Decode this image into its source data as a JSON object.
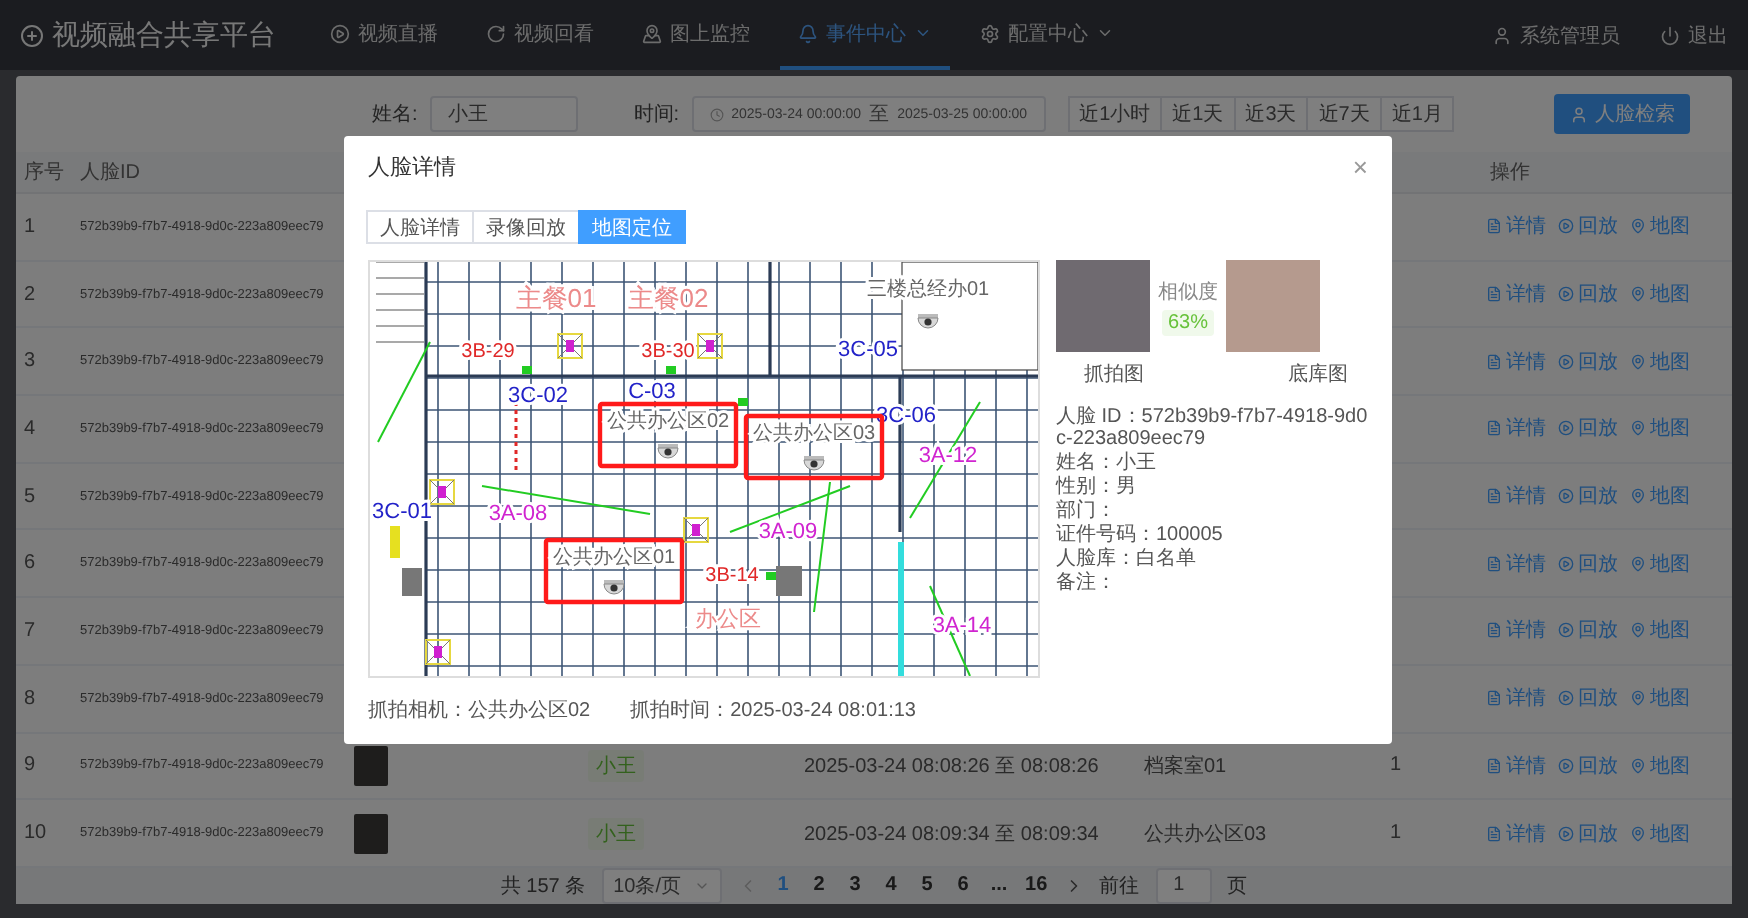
{
  "brand": {
    "title": "视频融合共享平台"
  },
  "nav": [
    {
      "label": "视频直播",
      "kind": "live",
      "selected": false,
      "dropdown": false
    },
    {
      "label": "视频回看",
      "kind": "playback",
      "selected": false,
      "dropdown": false
    },
    {
      "label": "图上监控",
      "kind": "map",
      "selected": false,
      "dropdown": false
    },
    {
      "label": "事件中心",
      "kind": "events",
      "selected": true,
      "dropdown": true
    },
    {
      "label": "配置中心",
      "kind": "config",
      "selected": false,
      "dropdown": true
    }
  ],
  "user": {
    "name": "系统管理员"
  },
  "logout": {
    "label": "退出"
  },
  "filters": {
    "name_label": "姓名:",
    "name_value": "小王",
    "time_label": "时间:",
    "start": "2025-03-24 00:00:00",
    "range_sep": "至",
    "end": "2025-03-25 00:00:00",
    "quick_ranges": [
      {
        "label": "近1小时"
      },
      {
        "label": "近1天"
      },
      {
        "label": "近3天"
      },
      {
        "label": "近7天"
      },
      {
        "label": "近1月"
      }
    ],
    "search_button": "人脸检索"
  },
  "table": {
    "columns": [
      {
        "label": "序号",
        "kind": "index"
      },
      {
        "label": "人脸ID",
        "kind": "id"
      },
      {
        "label": "操作",
        "kind": "actions"
      }
    ],
    "rows": [
      {
        "index": "1",
        "face_id": "572b39b9-f7b7-4918-9d0c-223a809eec79",
        "actions": [
          {
            "label": "详情",
            "kind": "detail"
          },
          {
            "label": "回放",
            "kind": "playback"
          },
          {
            "label": "地图",
            "kind": "map"
          }
        ]
      },
      {
        "index": "2",
        "face_id": "572b39b9-f7b7-4918-9d0c-223a809eec79",
        "actions": [
          {
            "label": "详情",
            "kind": "detail"
          },
          {
            "label": "回放",
            "kind": "playback"
          },
          {
            "label": "地图",
            "kind": "map"
          }
        ]
      },
      {
        "index": "3",
        "face_id": "572b39b9-f7b7-4918-9d0c-223a809eec79",
        "actions": [
          {
            "label": "详情",
            "kind": "detail"
          },
          {
            "label": "回放",
            "kind": "playback"
          },
          {
            "label": "地图",
            "kind": "map"
          }
        ]
      },
      {
        "index": "4",
        "face_id": "572b39b9-f7b7-4918-9d0c-223a809eec79",
        "actions": [
          {
            "label": "详情",
            "kind": "detail"
          },
          {
            "label": "回放",
            "kind": "playback"
          },
          {
            "label": "地图",
            "kind": "map"
          }
        ]
      },
      {
        "index": "5",
        "face_id": "572b39b9-f7b7-4918-9d0c-223a809eec79",
        "actions": [
          {
            "label": "详情",
            "kind": "detail"
          },
          {
            "label": "回放",
            "kind": "playback"
          },
          {
            "label": "地图",
            "kind": "map"
          }
        ]
      },
      {
        "index": "6",
        "face_id": "572b39b9-f7b7-4918-9d0c-223a809eec79",
        "actions": [
          {
            "label": "详情",
            "kind": "detail"
          },
          {
            "label": "回放",
            "kind": "playback"
          },
          {
            "label": "地图",
            "kind": "map"
          }
        ]
      },
      {
        "index": "7",
        "face_id": "572b39b9-f7b7-4918-9d0c-223a809eec79",
        "actions": [
          {
            "label": "详情",
            "kind": "detail"
          },
          {
            "label": "回放",
            "kind": "playback"
          },
          {
            "label": "地图",
            "kind": "map"
          }
        ]
      },
      {
        "index": "8",
        "face_id": "572b39b9-f7b7-4918-9d0c-223a809eec79",
        "actions": [
          {
            "label": "详情",
            "kind": "detail"
          },
          {
            "label": "回放",
            "kind": "playback"
          },
          {
            "label": "地图",
            "kind": "map"
          }
        ]
      },
      {
        "index": "9",
        "face_id": "572b39b9-f7b7-4918-9d0c-223a809eec79",
        "name": "小王",
        "time": "2025-03-24 08:08:26 至 08:08:26",
        "location": "档案室01",
        "count": "1",
        "actions": [
          {
            "label": "详情",
            "kind": "detail"
          },
          {
            "label": "回放",
            "kind": "playback"
          },
          {
            "label": "地图",
            "kind": "map"
          }
        ]
      },
      {
        "index": "10",
        "face_id": "572b39b9-f7b7-4918-9d0c-223a809eec79",
        "name": "小王",
        "time": "2025-03-24 08:09:34 至 08:09:34",
        "location": "公共办公区03",
        "count": "1",
        "actions": [
          {
            "label": "详情",
            "kind": "detail"
          },
          {
            "label": "回放",
            "kind": "playback"
          },
          {
            "label": "地图",
            "kind": "map"
          }
        ]
      }
    ]
  },
  "pagination": {
    "total": "共 157 条",
    "page_size": "10条/页",
    "pages": [
      {
        "label": "1",
        "selected": true
      },
      {
        "label": "2",
        "selected": false
      },
      {
        "label": "3",
        "selected": false
      },
      {
        "label": "4",
        "selected": false
      },
      {
        "label": "5",
        "selected": false
      },
      {
        "label": "6",
        "selected": false
      },
      {
        "label": "...",
        "selected": false
      },
      {
        "label": "16",
        "selected": false
      }
    ],
    "goto_label": "前往",
    "goto_value": "1",
    "page_unit": "页"
  },
  "modal": {
    "title": "人脸详情",
    "close": "×",
    "tabs": [
      {
        "label": "人脸详情",
        "selected": false
      },
      {
        "label": "录像回放",
        "selected": false
      },
      {
        "label": "地图定位",
        "selected": true
      }
    ],
    "map": {
      "rooms": [
        {
          "label": "主餐01",
          "color": "#ec8a8a"
        },
        {
          "label": "主餐02",
          "color": "#ec8a8a"
        },
        {
          "label": "3B-29",
          "color": "#e02828"
        },
        {
          "label": "3B-30",
          "color": "#e02828"
        },
        {
          "label": "3C-05",
          "color": "#2222c8"
        },
        {
          "label": "3C-02",
          "color": "#2222c8"
        },
        {
          "label": "C-03",
          "color": "#2222c8"
        },
        {
          "label": "3C-06",
          "color": "#2222c8"
        },
        {
          "label": "3A-12",
          "color": "#d024d0"
        },
        {
          "label": "3C-01",
          "color": "#2222c8"
        },
        {
          "label": "3A-08",
          "color": "#d024d0"
        },
        {
          "label": "3A-09",
          "color": "#d024d0"
        },
        {
          "label": "3B-14",
          "color": "#e02828"
        },
        {
          "label": "办公区",
          "color": "#ec8a8a"
        },
        {
          "label": "3A-14",
          "color": "#d024d0"
        }
      ],
      "cameras": [
        {
          "label": "三楼总经办01",
          "highlighted": false
        },
        {
          "label": "公共办公区02",
          "highlighted": true
        },
        {
          "label": "公共办公区03",
          "highlighted": true
        },
        {
          "label": "公共办公区01",
          "highlighted": true
        }
      ]
    },
    "similarity": {
      "label": "相似度",
      "value": "63%"
    },
    "captions": [
      "抓拍图",
      "底库图"
    ],
    "info": [
      "人脸 ID：572b39b9-f7b7-4918-9d0c-223a809eec79",
      "姓名：小王",
      "性别：男",
      "部门：",
      "证件号码：100005",
      "人脸库：白名单",
      "备注："
    ],
    "footer": [
      "抓拍相机：公共办公区02",
      "抓拍时间：2025-03-24 08:01:13"
    ]
  }
}
